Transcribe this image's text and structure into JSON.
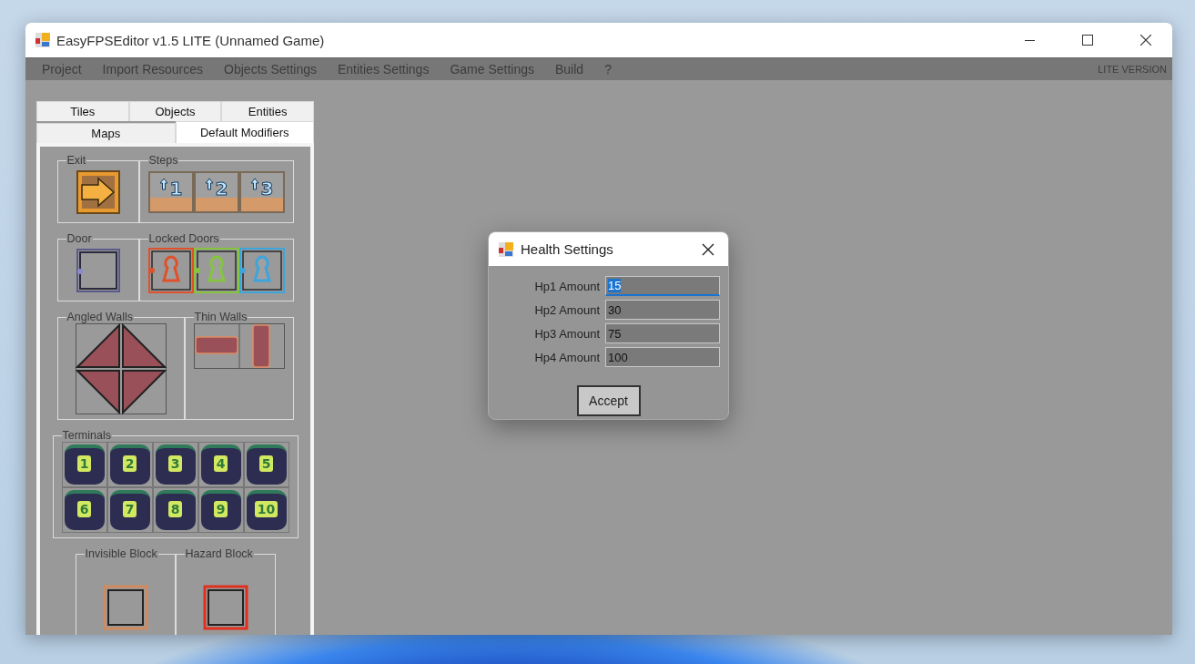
{
  "window": {
    "title": "EasyFPSEditor v1.5 LITE (Unnamed Game)"
  },
  "menu": {
    "disabled": true,
    "items": [
      "Project",
      "Import Resources",
      "Objects Settings",
      "Entities Settings",
      "Game Settings",
      "Build",
      "?"
    ],
    "edition": "LITE VERSION"
  },
  "tabs": [
    [
      {
        "label": "Tiles",
        "selected": false
      },
      {
        "label": "Objects",
        "selected": false
      },
      {
        "label": "Entities",
        "selected": false
      }
    ],
    [
      {
        "label": "Maps",
        "selected": false
      },
      {
        "label": "Default Modifiers",
        "selected": true
      }
    ]
  ],
  "exit": {
    "legend": "Exit"
  },
  "steps": {
    "legend": "Steps",
    "tiles": [
      "1",
      "2",
      "3"
    ]
  },
  "door": {
    "legend": "Door"
  },
  "locked_doors": {
    "legend": "Locked Doors",
    "tiles": [
      {
        "color": "#e0502a"
      },
      {
        "color": "#86c440"
      },
      {
        "color": "#3ea4dc"
      }
    ]
  },
  "angled_walls": {
    "legend": "Angled Walls"
  },
  "thin_walls": {
    "legend": "Thin Walls"
  },
  "terminals": {
    "legend": "Terminals",
    "tiles": [
      "1",
      "2",
      "3",
      "4",
      "5",
      "6",
      "7",
      "8",
      "9",
      "10"
    ]
  },
  "invisible_block": {
    "legend": "Invisible Block"
  },
  "hazard_block": {
    "legend": "Hazard Block"
  },
  "dialog": {
    "title": "Health Settings",
    "fields": [
      {
        "label": "Hp1 Amount",
        "value": "15",
        "focused": true
      },
      {
        "label": "Hp2 Amount",
        "value": "30",
        "focused": false
      },
      {
        "label": "Hp3 Amount",
        "value": "75",
        "focused": false
      },
      {
        "label": "Hp4 Amount",
        "value": "100",
        "focused": false
      }
    ],
    "button": "Accept"
  }
}
